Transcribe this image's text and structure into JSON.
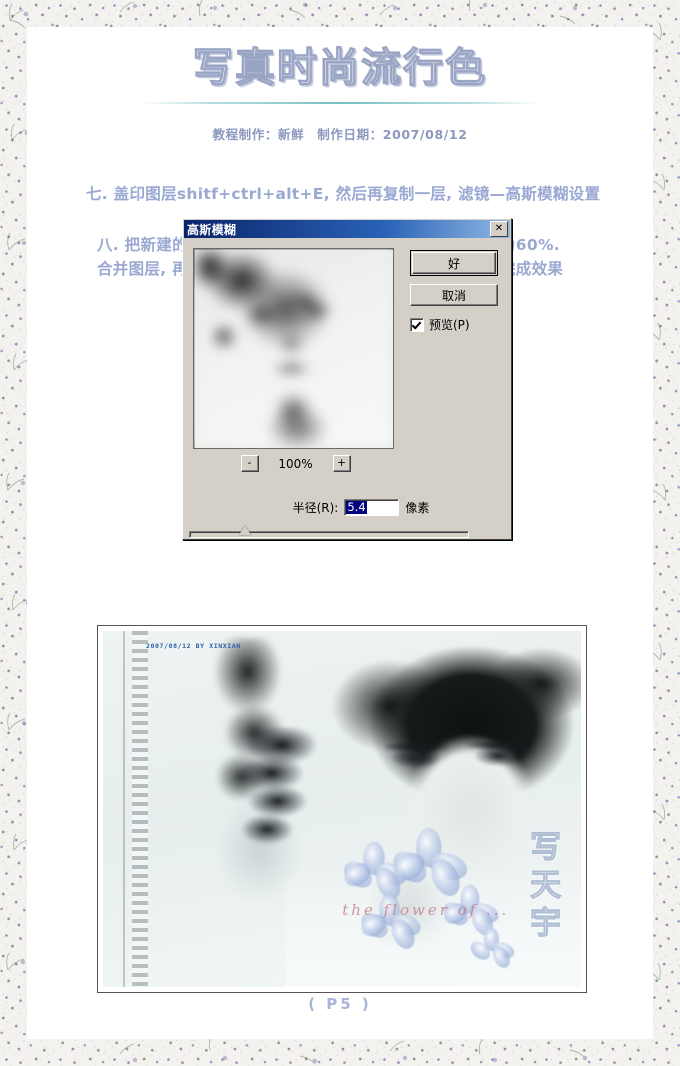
{
  "document": {
    "title": "写真时尚流行色",
    "byline": "教程制作：新鲜　制作日期：2007/08/12",
    "page_marker": "( P5 )"
  },
  "steps": [
    {
      "id": "step-7",
      "text": "七. 盖印图层shitf+ctrl+alt+E, 然后再复制一层, 滤镜—高斯模糊设置"
    },
    {
      "id": "step-8",
      "line1": "八. 把新建的图层属性设置为柔光, 然后调整图层不透明度为60%.",
      "line2": "合并图层, 再做下细节处理后用笔刷和文字修饰一下, 最终完成效果"
    }
  ],
  "dialog": {
    "title": "高斯模糊",
    "close_label": "✕",
    "ok_label": "好",
    "cancel_label": "取消",
    "preview_checkbox_label": "预览(P)",
    "preview_checked": true,
    "zoom_out_label": "-",
    "zoom_level": "100%",
    "zoom_in_label": "+",
    "radius_label": "半径(R):",
    "radius_value": "5.4",
    "radius_unit": "像素",
    "slider_position_percent": 20
  },
  "final_photo": {
    "watermark": "2007/08/12  BY XINXIAN",
    "decor_vertical_text": "写天宇",
    "decor_script_text": "the flower of ..."
  },
  "colors": {
    "title_stroke": "#9aa4c4",
    "step_text": "#9aa8d2",
    "byline": "#8c98bf",
    "rule_teal": "#5fb4b6",
    "dialog_face": "#d4d0c8",
    "titlebar_start": "#0a246a",
    "titlebar_end": "#92b8e4",
    "selection_blue": "#000080",
    "page_marker": "#a8b4d8",
    "watermark_blue": "#2f5fa8",
    "script_pink": "#c47a88"
  }
}
